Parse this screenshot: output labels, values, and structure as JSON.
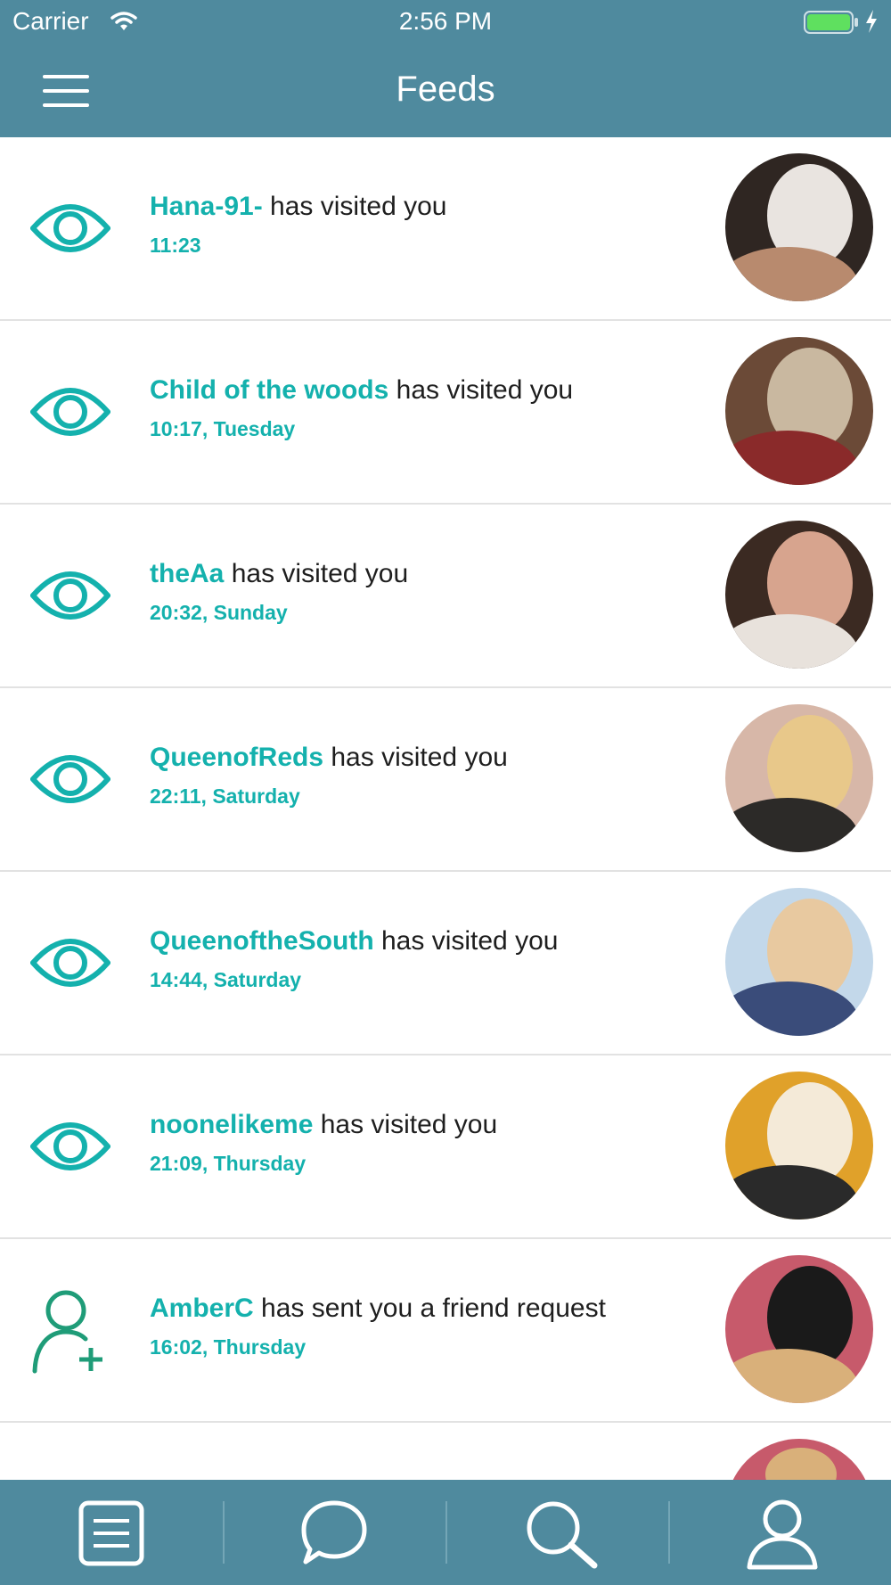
{
  "status_bar": {
    "carrier": "Carrier",
    "time": "2:56 PM"
  },
  "header": {
    "title": "Feeds"
  },
  "feeds": [
    {
      "icon": "eye-icon",
      "username": "Hana-91-",
      "action": " has visited you",
      "time": "11:23"
    },
    {
      "icon": "eye-icon",
      "username": "Child of the woods",
      "action": " has visited you",
      "time": "10:17, Tuesday"
    },
    {
      "icon": "eye-icon",
      "username": "theAa",
      "action": " has visited you",
      "time": "20:32, Sunday"
    },
    {
      "icon": "eye-icon",
      "username": "QueenofReds",
      "action": " has visited you",
      "time": "22:11, Saturday"
    },
    {
      "icon": "eye-icon",
      "username": "QueenoftheSouth",
      "action": " has visited you",
      "time": "14:44, Saturday"
    },
    {
      "icon": "eye-icon",
      "username": "noonelikeme",
      "action": " has visited you",
      "time": "21:09, Thursday"
    },
    {
      "icon": "add-friend-icon",
      "username": "AmberC",
      "action": " has sent you a friend request",
      "time": "16:02, Thursday"
    }
  ],
  "tabs": [
    {
      "name": "feed-tab",
      "icon": "list-icon"
    },
    {
      "name": "messages-tab",
      "icon": "chat-bubble-icon"
    },
    {
      "name": "search-tab",
      "icon": "search-icon"
    },
    {
      "name": "profile-tab",
      "icon": "profile-icon"
    }
  ],
  "colors": {
    "bar": "#4f8a9e",
    "accent": "#14b1ad",
    "text": "#1e1e1e",
    "add_friend": "#1f9c78"
  }
}
